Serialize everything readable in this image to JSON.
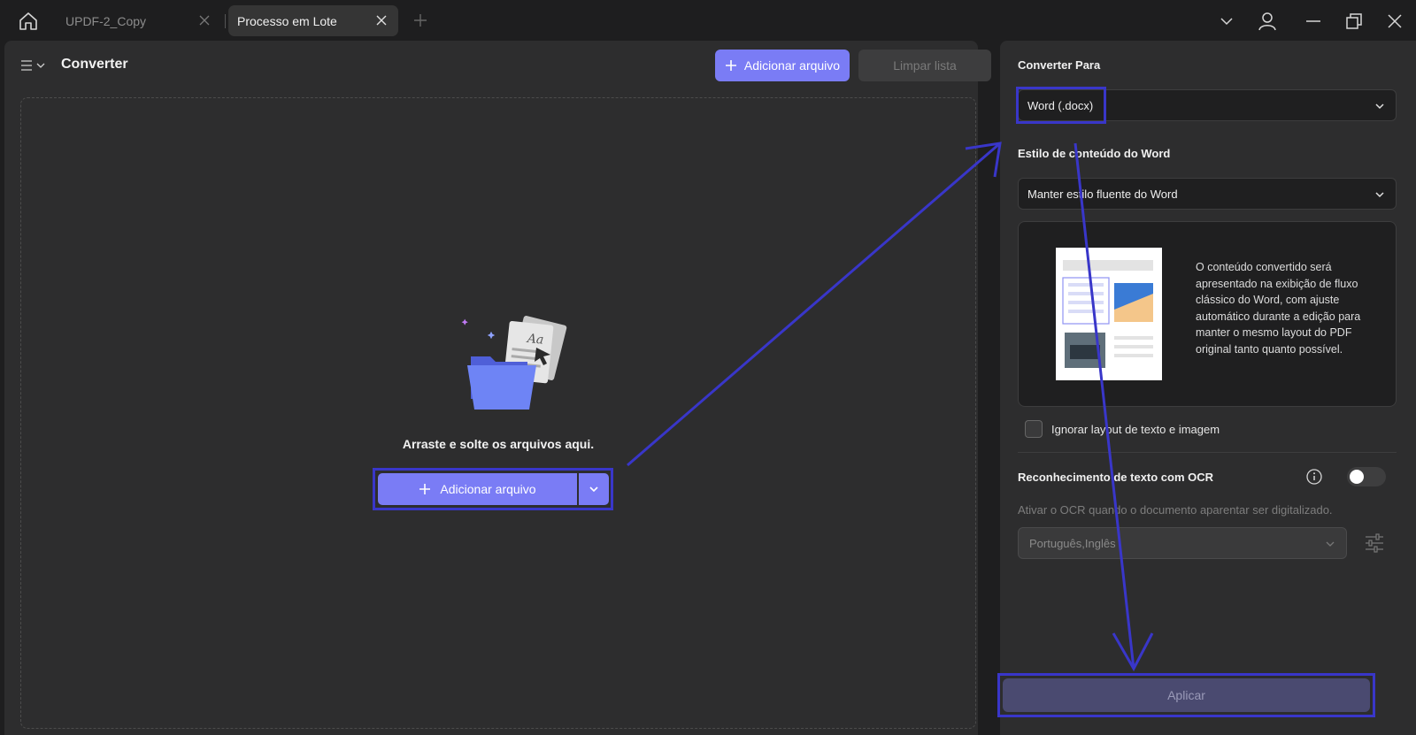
{
  "tabs": [
    {
      "label": "UPDF-2_Copy"
    },
    {
      "label": "Processo em Lote"
    }
  ],
  "left": {
    "title": "Converter",
    "add_file_label": "Adicionar arquivo",
    "clear_list_label": "Limpar lista",
    "drop_text": "Arraste e solte os arquivos aqui.",
    "center_add_label": "Adicionar arquivo"
  },
  "right": {
    "convert_to_label": "Converter Para",
    "convert_to_value": "Word (.docx)",
    "word_style_label": "Estilo de conteúdo do Word",
    "word_style_value": "Manter estilo fluente do Word",
    "preview_description": "O conteúdo convertido será apresentado na exibição de fluxo clássico do Word, com ajuste automático durante a edição para manter o mesmo layout do PDF original tanto quanto possível.",
    "ignore_layout_label": "Ignorar layout de texto e imagem",
    "ocr_label": "Reconhecimento de texto com OCR",
    "ocr_hint": "Ativar o OCR quando o documento aparentar ser digitalizado.",
    "ocr_languages": "Português,Inglês",
    "apply_label": "Aplicar"
  },
  "colors": {
    "accent": "#7a7cf5",
    "annotation": "#3936c9",
    "panel": "#2d2d2e",
    "background": "#1e1e1f"
  },
  "icons": [
    "home-icon",
    "close-icon",
    "plus-icon",
    "chevron-down-icon",
    "user-icon",
    "minimize-icon",
    "restore-icon",
    "menu-icon",
    "info-icon",
    "settings-icon",
    "folder-illustration"
  ]
}
